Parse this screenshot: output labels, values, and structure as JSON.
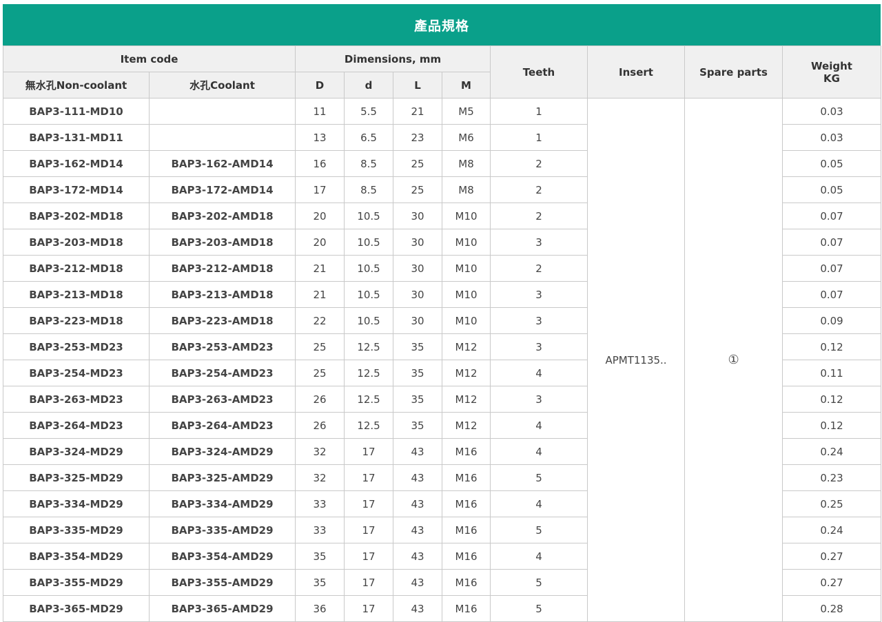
{
  "title": "產品規格",
  "headers": {
    "item_code": "Item code",
    "dimensions": "Dimensions, mm",
    "teeth": "Teeth",
    "insert": "Insert",
    "spare_parts": "Spare parts",
    "weight_line1": "Weight",
    "weight_line2": "KG",
    "non_coolant": "無水孔Non-coolant",
    "coolant": "水孔Coolant",
    "D": "D",
    "d": "d",
    "L": "L",
    "M": "M"
  },
  "insert_value": "APMT1135..",
  "spare_parts_value": "①",
  "rows": [
    {
      "nc": "BAP3-111-MD10",
      "c": "",
      "D": "11",
      "d": "5.5",
      "L": "21",
      "M": "M5",
      "teeth": "1",
      "weight": "0.03"
    },
    {
      "nc": "BAP3-131-MD11",
      "c": "",
      "D": "13",
      "d": "6.5",
      "L": "23",
      "M": "M6",
      "teeth": "1",
      "weight": "0.03"
    },
    {
      "nc": "BAP3-162-MD14",
      "c": "BAP3-162-AMD14",
      "D": "16",
      "d": "8.5",
      "L": "25",
      "M": "M8",
      "teeth": "2",
      "weight": "0.05"
    },
    {
      "nc": "BAP3-172-MD14",
      "c": "BAP3-172-AMD14",
      "D": "17",
      "d": "8.5",
      "L": "25",
      "M": "M8",
      "teeth": "2",
      "weight": "0.05"
    },
    {
      "nc": "BAP3-202-MD18",
      "c": "BAP3-202-AMD18",
      "D": "20",
      "d": "10.5",
      "L": "30",
      "M": "M10",
      "teeth": "2",
      "weight": "0.07"
    },
    {
      "nc": "BAP3-203-MD18",
      "c": "BAP3-203-AMD18",
      "D": "20",
      "d": "10.5",
      "L": "30",
      "M": "M10",
      "teeth": "3",
      "weight": "0.07"
    },
    {
      "nc": "BAP3-212-MD18",
      "c": "BAP3-212-AMD18",
      "D": "21",
      "d": "10.5",
      "L": "30",
      "M": "M10",
      "teeth": "2",
      "weight": "0.07"
    },
    {
      "nc": "BAP3-213-MD18",
      "c": "BAP3-213-AMD18",
      "D": "21",
      "d": "10.5",
      "L": "30",
      "M": "M10",
      "teeth": "3",
      "weight": "0.07"
    },
    {
      "nc": "BAP3-223-MD18",
      "c": "BAP3-223-AMD18",
      "D": "22",
      "d": "10.5",
      "L": "30",
      "M": "M10",
      "teeth": "3",
      "weight": "0.09"
    },
    {
      "nc": "BAP3-253-MD23",
      "c": "BAP3-253-AMD23",
      "D": "25",
      "d": "12.5",
      "L": "35",
      "M": "M12",
      "teeth": "3",
      "weight": "0.12"
    },
    {
      "nc": "BAP3-254-MD23",
      "c": "BAP3-254-AMD23",
      "D": "25",
      "d": "12.5",
      "L": "35",
      "M": "M12",
      "teeth": "4",
      "weight": "0.11"
    },
    {
      "nc": "BAP3-263-MD23",
      "c": "BAP3-263-AMD23",
      "D": "26",
      "d": "12.5",
      "L": "35",
      "M": "M12",
      "teeth": "3",
      "weight": "0.12"
    },
    {
      "nc": "BAP3-264-MD23",
      "c": "BAP3-264-AMD23",
      "D": "26",
      "d": "12.5",
      "L": "35",
      "M": "M12",
      "teeth": "4",
      "weight": "0.12"
    },
    {
      "nc": "BAP3-324-MD29",
      "c": "BAP3-324-AMD29",
      "D": "32",
      "d": "17",
      "L": "43",
      "M": "M16",
      "teeth": "4",
      "weight": "0.24"
    },
    {
      "nc": "BAP3-325-MD29",
      "c": "BAP3-325-AMD29",
      "D": "32",
      "d": "17",
      "L": "43",
      "M": "M16",
      "teeth": "5",
      "weight": "0.23"
    },
    {
      "nc": "BAP3-334-MD29",
      "c": "BAP3-334-AMD29",
      "D": "33",
      "d": "17",
      "L": "43",
      "M": "M16",
      "teeth": "4",
      "weight": "0.25"
    },
    {
      "nc": "BAP3-335-MD29",
      "c": "BAP3-335-AMD29",
      "D": "33",
      "d": "17",
      "L": "43",
      "M": "M16",
      "teeth": "5",
      "weight": "0.24"
    },
    {
      "nc": "BAP3-354-MD29",
      "c": "BAP3-354-AMD29",
      "D": "35",
      "d": "17",
      "L": "43",
      "M": "M16",
      "teeth": "4",
      "weight": "0.27"
    },
    {
      "nc": "BAP3-355-MD29",
      "c": "BAP3-355-AMD29",
      "D": "35",
      "d": "17",
      "L": "43",
      "M": "M16",
      "teeth": "5",
      "weight": "0.27"
    },
    {
      "nc": "BAP3-365-MD29",
      "c": "BAP3-365-AMD29",
      "D": "36",
      "d": "17",
      "L": "43",
      "M": "M16",
      "teeth": "5",
      "weight": "0.28"
    }
  ]
}
